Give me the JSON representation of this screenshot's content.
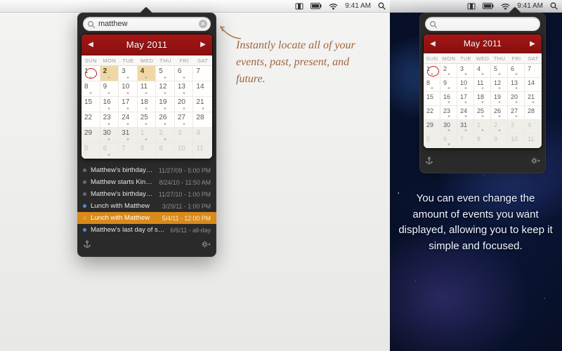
{
  "menubar": {
    "time": "9:41 AM"
  },
  "search": {
    "value": "matthew",
    "placeholder": ""
  },
  "calendar": {
    "title": "May 2011",
    "dow": [
      "SUN",
      "MON",
      "TUE",
      "WED",
      "THU",
      "FRI",
      "SAT"
    ],
    "today": 1,
    "highlight": [
      2,
      4
    ],
    "weeks": [
      [
        {
          "n": 1,
          "dot": true
        },
        {
          "n": 2,
          "dot": true
        },
        {
          "n": 3,
          "dot": true
        },
        {
          "n": 4,
          "dot": true
        },
        {
          "n": 5,
          "dot": true
        },
        {
          "n": 6,
          "dot": true
        },
        {
          "n": 7,
          "dot": false
        }
      ],
      [
        {
          "n": 8,
          "dot": true
        },
        {
          "n": 9,
          "dot": true
        },
        {
          "n": 10,
          "dot": true
        },
        {
          "n": 11,
          "dot": true
        },
        {
          "n": 12,
          "dot": true
        },
        {
          "n": 13,
          "dot": true
        },
        {
          "n": 14,
          "dot": false
        }
      ],
      [
        {
          "n": 15,
          "dot": false
        },
        {
          "n": 16,
          "dot": true
        },
        {
          "n": 17,
          "dot": true
        },
        {
          "n": 18,
          "dot": true
        },
        {
          "n": 19,
          "dot": true
        },
        {
          "n": 20,
          "dot": true
        },
        {
          "n": 21,
          "dot": true
        }
      ],
      [
        {
          "n": 22,
          "dot": false
        },
        {
          "n": 23,
          "dot": true
        },
        {
          "n": 24,
          "dot": true
        },
        {
          "n": 25,
          "dot": true
        },
        {
          "n": 26,
          "dot": true
        },
        {
          "n": 27,
          "dot": true
        },
        {
          "n": 28,
          "dot": false
        }
      ],
      [
        {
          "n": 29,
          "dot": false
        },
        {
          "n": 30,
          "dot": true
        },
        {
          "n": 31,
          "dot": true
        },
        {
          "n": 1,
          "dot": true,
          "other": true
        },
        {
          "n": 2,
          "dot": true,
          "other": true
        },
        {
          "n": 3,
          "dot": false,
          "other": true
        },
        {
          "n": 4,
          "dot": false,
          "other": true
        }
      ],
      [
        {
          "n": 5,
          "dot": false,
          "other": true
        },
        {
          "n": 6,
          "dot": true,
          "other": true
        },
        {
          "n": 7,
          "dot": false,
          "other": true
        },
        {
          "n": 8,
          "dot": false,
          "other": true
        },
        {
          "n": 9,
          "dot": false,
          "other": true
        },
        {
          "n": 10,
          "dot": false,
          "other": true
        },
        {
          "n": 11,
          "dot": false,
          "other": true
        }
      ]
    ]
  },
  "events": [
    {
      "title": "Matthew's birthday party",
      "meta": "11/27/09 - 5:00 PM",
      "color": "#6b6b6b"
    },
    {
      "title": "Matthew starts Kindergarten",
      "meta": "8/24/10 - 11:50 AM",
      "color": "#6b6b6b"
    },
    {
      "title": "Matthew's birthday party",
      "meta": "11/27/10 - 1:00 PM",
      "color": "#6b6b6b"
    },
    {
      "title": "Lunch with Matthew",
      "meta": "3/29/11 - 1:00 PM",
      "color": "#4d90d6"
    },
    {
      "title": "Lunch with Matthew",
      "meta": "5/4/11 - 12:00 PM",
      "color": "#e39a2a",
      "selected": true
    },
    {
      "title": "Matthew's last day of school",
      "meta": "6/6/11 - all-day",
      "color": "#4d90d6"
    }
  ],
  "callouts": {
    "left": "Instantly locate all of your events, past, present, and future.",
    "right": "You can even change the amount of events you want displayed, allowing you to keep it simple and focused."
  }
}
